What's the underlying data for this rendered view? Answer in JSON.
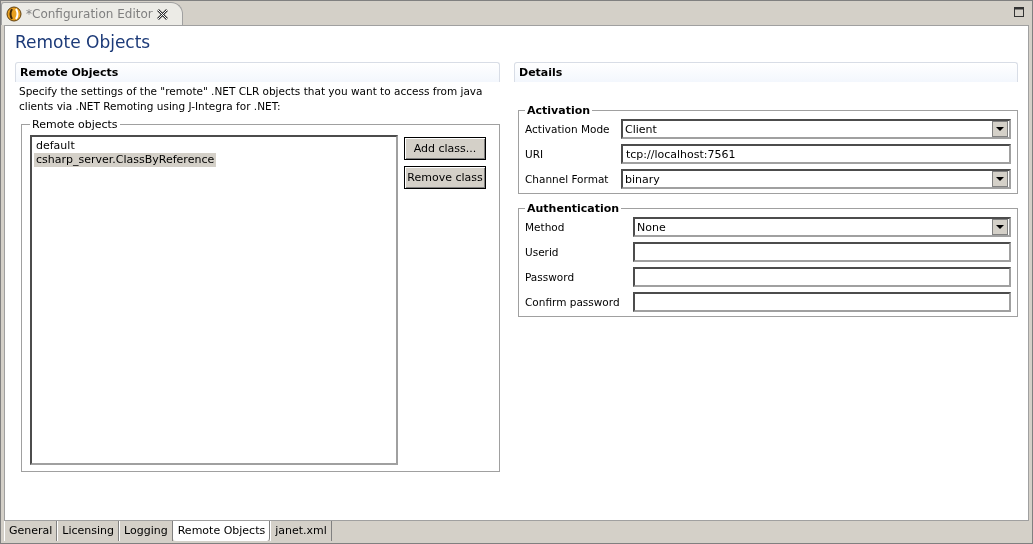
{
  "editor_tab": {
    "title": "*Configuration Editor",
    "dirty": true
  },
  "page_title": "Remote Objects",
  "left": {
    "section_title": "Remote Objects",
    "description": "Specify the settings of the \"remote\" .NET CLR objects that you want to access from java clients via .NET Remoting using J-Integra for .NET:",
    "group_title": "Remote objects",
    "items": [
      {
        "label": "default",
        "selected": false
      },
      {
        "label": "csharp_server.ClassByReference",
        "selected": true
      }
    ],
    "buttons": [
      "Add class...",
      "Remove class"
    ]
  },
  "details": {
    "section_title": "Details",
    "groups": [
      {
        "title": "Activation",
        "fields": [
          {
            "kind": "select",
            "label": "Activation Mode",
            "value": "Client"
          },
          {
            "kind": "text",
            "label": "URI",
            "value": "tcp://localhost:7561"
          },
          {
            "kind": "select",
            "label": "Channel Format",
            "value": "binary"
          }
        ]
      },
      {
        "title": "Authentication",
        "fields": [
          {
            "kind": "select",
            "label": "Method",
            "value": "None"
          },
          {
            "kind": "text",
            "label": "Userid"
          },
          {
            "kind": "text",
            "label": "Password"
          },
          {
            "kind": "text",
            "label": "Confirm password"
          }
        ]
      }
    ]
  },
  "bottom_tabs": [
    {
      "label": "General",
      "selected": false
    },
    {
      "label": "Licensing",
      "selected": false
    },
    {
      "label": "Logging",
      "selected": false
    },
    {
      "label": "Remote Objects",
      "selected": true
    },
    {
      "label": "janet.xml",
      "selected": false
    }
  ]
}
